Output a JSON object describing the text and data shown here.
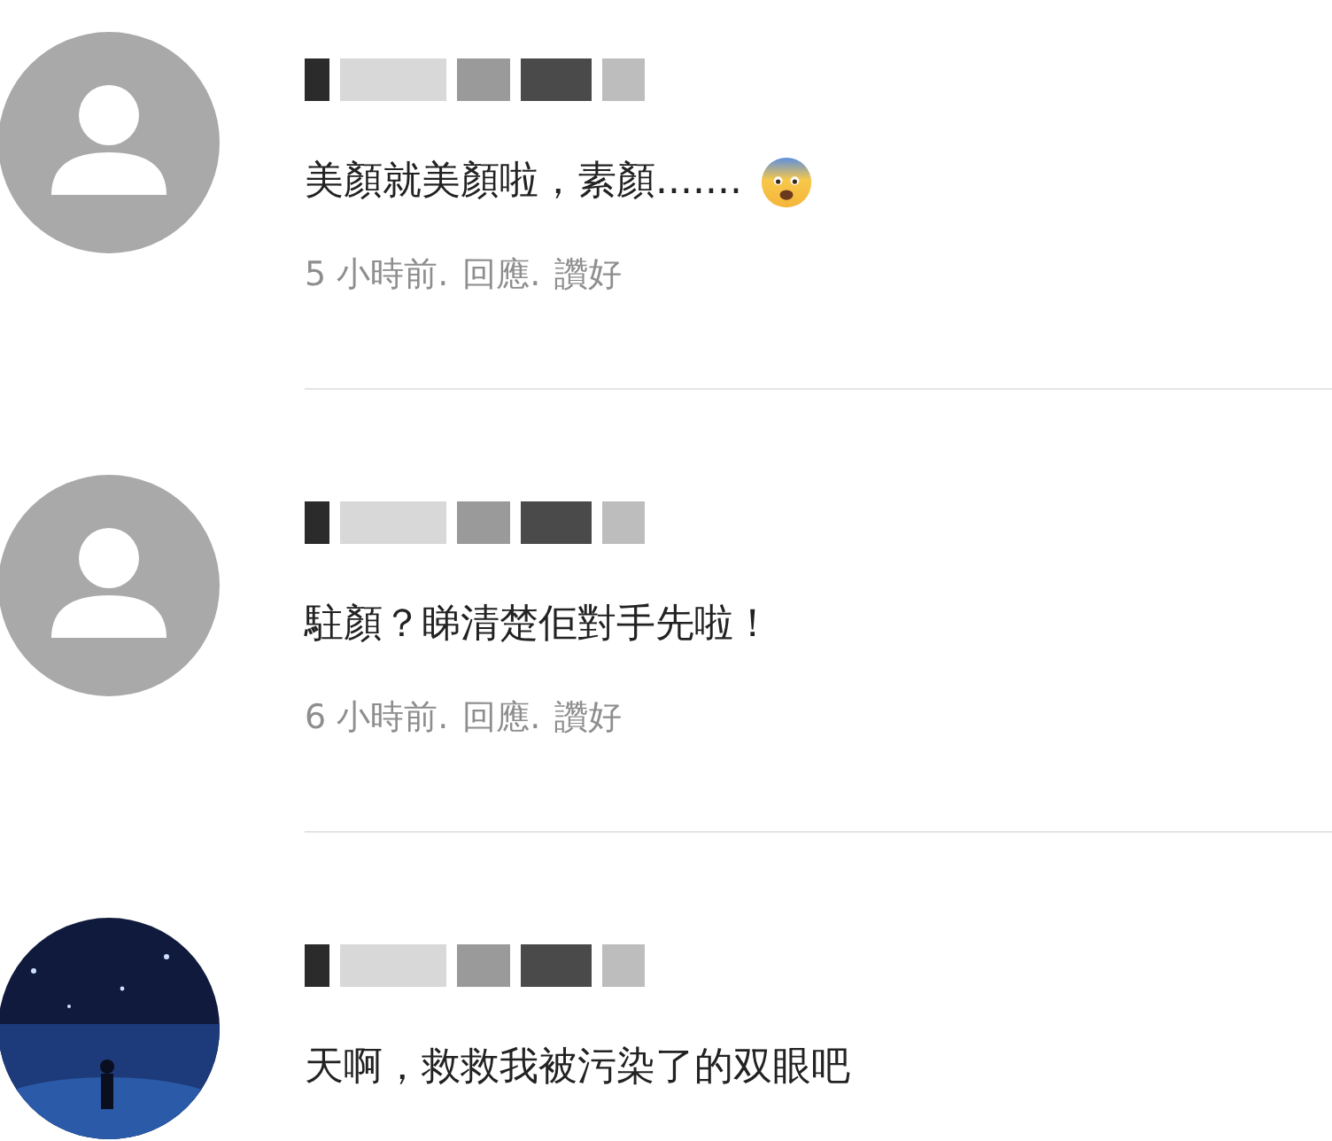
{
  "comments": [
    {
      "avatar": {
        "kind": "default"
      },
      "text": "美顏就美顏啦，素顏.......",
      "trailing_icon": true,
      "meta": {
        "time": "5 小時前.",
        "reply": "回應.",
        "like": "讚好"
      }
    },
    {
      "avatar": {
        "kind": "default"
      },
      "text": "駐顏？睇清楚佢對手先啦！",
      "meta": {
        "time": "6 小時前.",
        "reply": "回應.",
        "like": "讚好"
      }
    },
    {
      "text": "天啊，救救我被污染了的双眼吧"
    }
  ]
}
